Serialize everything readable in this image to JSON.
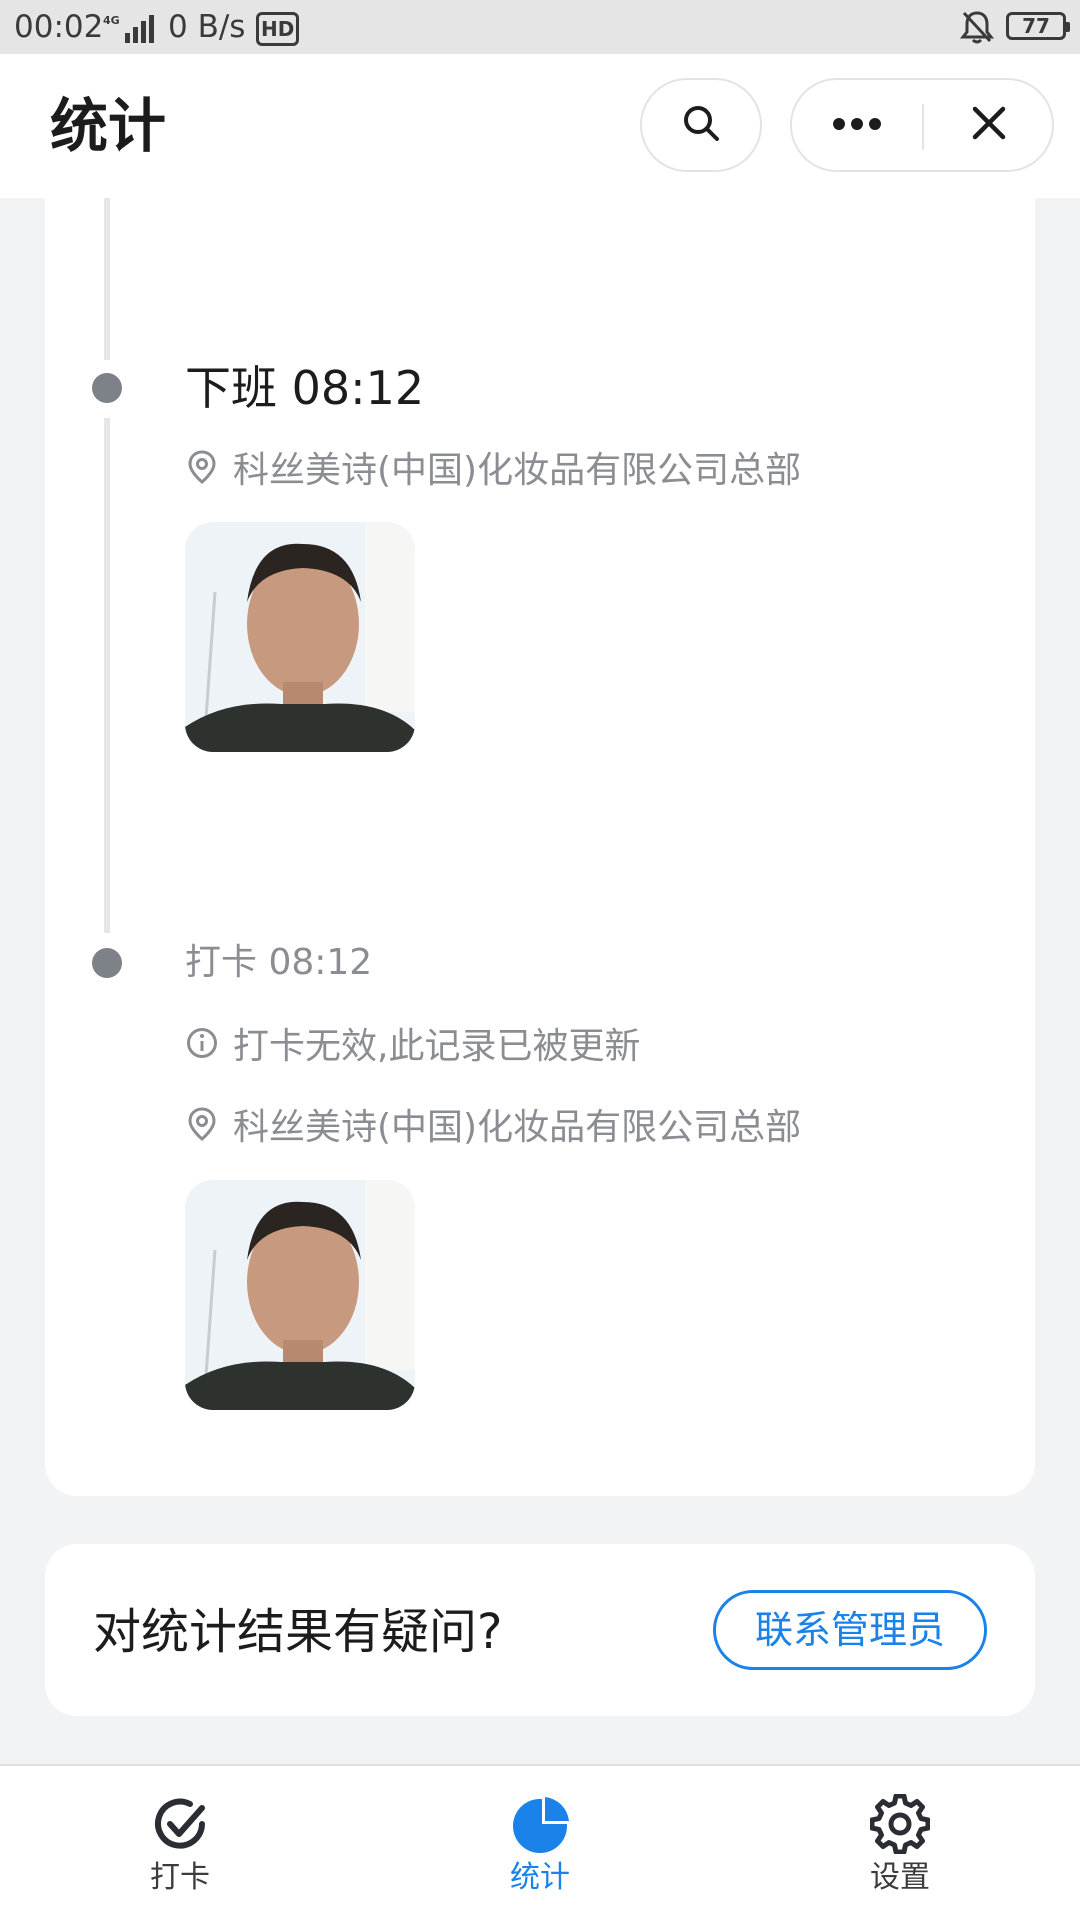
{
  "status_bar": {
    "time": "00:02",
    "network": "4G",
    "speed": "0 B/s",
    "hd": "HD",
    "battery": "77",
    "icons": [
      "signal-icon",
      "hd-icon",
      "bell-muted-icon",
      "battery-icon"
    ]
  },
  "header": {
    "title": "统计",
    "search_icon": "search-icon",
    "more_icon": "more-dots-icon",
    "close_icon": "close-icon"
  },
  "timeline": {
    "events": [
      {
        "title": "下班 08:12",
        "location": "科丝美诗(中国)化妆品有限公司总部",
        "location_icon": "location-pin-icon"
      },
      {
        "title": "打卡 08:12",
        "notice": "打卡无效,此记录已被更新",
        "notice_icon": "info-icon",
        "location": "科丝美诗(中国)化妆品有限公司总部",
        "location_icon": "location-pin-icon"
      }
    ]
  },
  "question": {
    "text": "对统计结果有疑问?",
    "button_label": "联系管理员"
  },
  "tabs": [
    {
      "label": "打卡",
      "icon": "check-circle-icon"
    },
    {
      "label": "统计",
      "icon": "pie-chart-icon",
      "active": true
    },
    {
      "label": "设置",
      "icon": "gear-icon"
    }
  ],
  "colors": {
    "accent": "#1a82e8",
    "background": "#f2f3f5",
    "muted_text": "#8a8d92",
    "timeline_dot": "#7d8289"
  }
}
